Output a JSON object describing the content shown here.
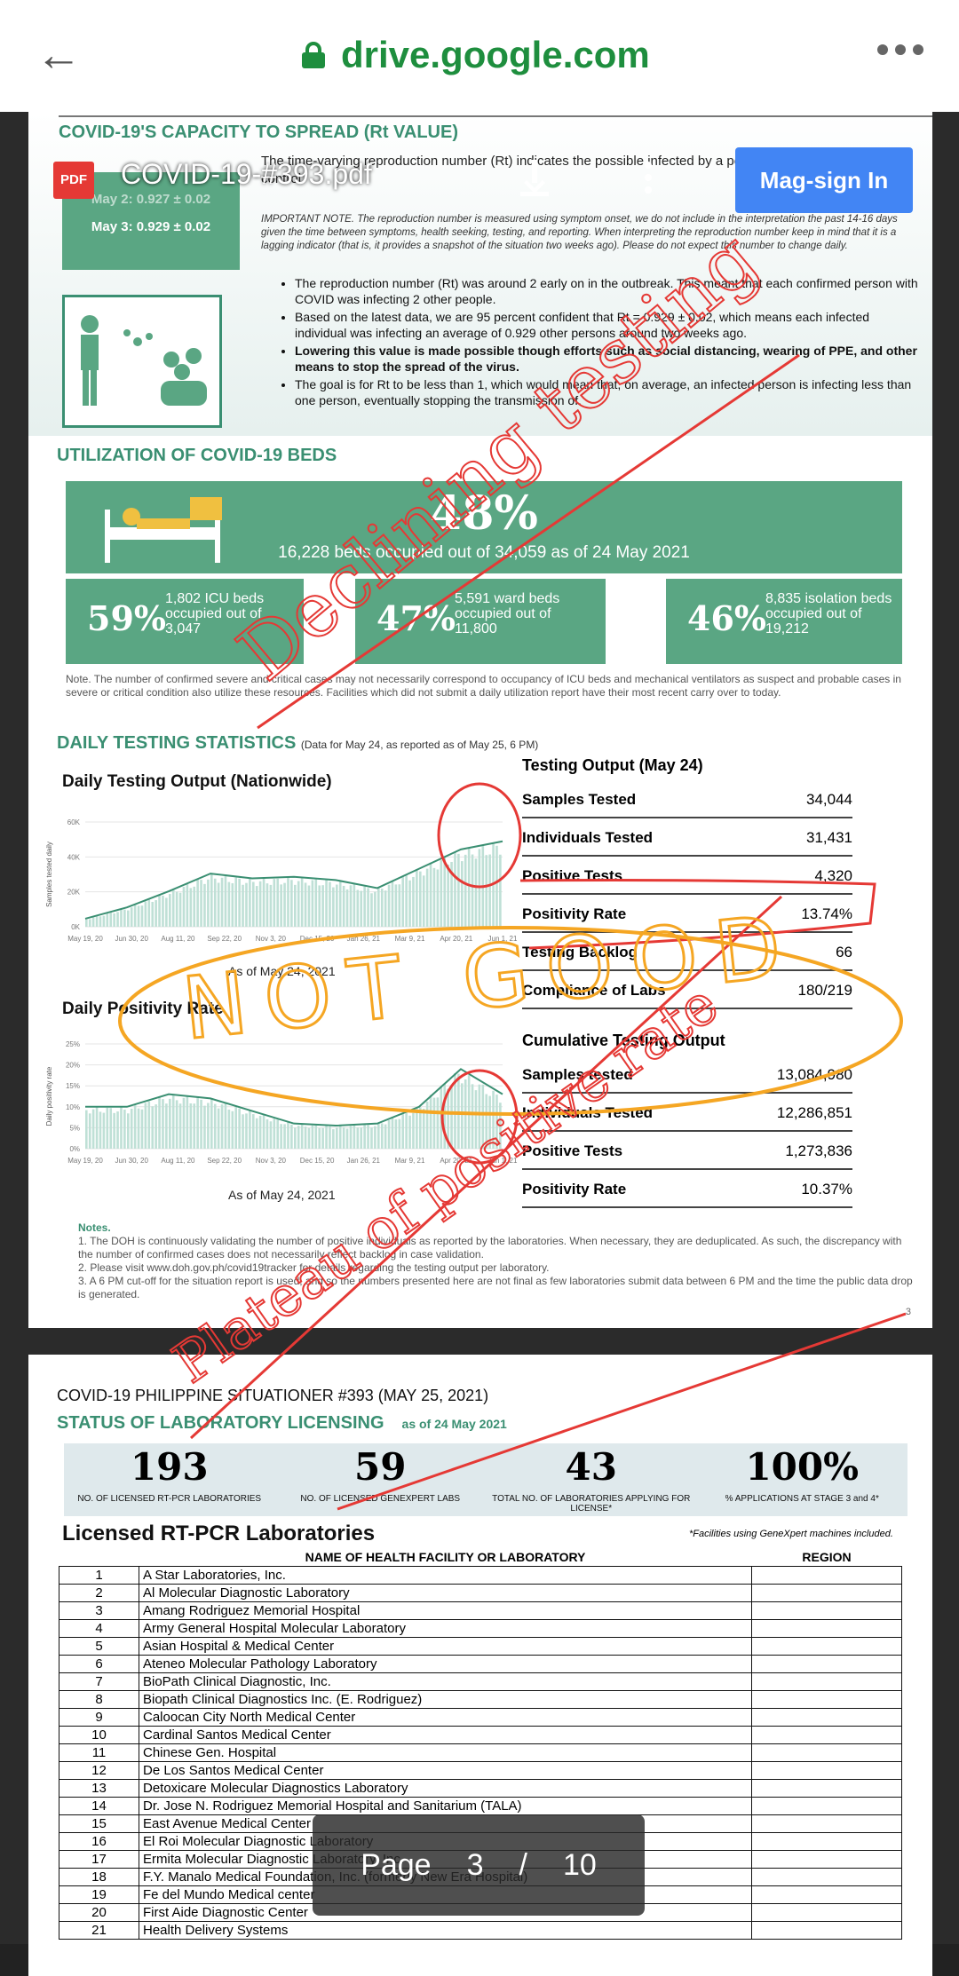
{
  "browser": {
    "url": "drive.google.com"
  },
  "pdf_toolbar": {
    "badge": "PDF",
    "file_name": "COVID-19-#393.pdf",
    "sign_in_label": "Mag-sign In"
  },
  "rt_section": {
    "title": "COVID-19'S CAPACITY TO SPREAD (Rt VALUE)",
    "box_line1": "May 2: 0.927 ± 0.02",
    "box_line2": "May 3: 0.929 ± 0.02",
    "intro": "The time-varying reproduction number (Rt) indicates the possible infected by a person, at a specific time with control",
    "important_note": "IMPORTANT NOTE. The reproduction number is measured using symptom onset, we do not include in the interpretation the past 14-16 days given the time between symptoms, health seeking, testing, and reporting. When interpreting the reproduction number keep in mind that it is a lagging indicator (that is, it provides a snapshot of the situation two weeks ago). Please do not expect this number to change daily.",
    "bullets": [
      "The reproduction number (Rt) was around 2 early on in the outbreak. This meant that each confirmed person with COVID was infecting 2 other people.",
      "Based on the latest data, we are 95 percent confident that Rt = 0.929 ± 0.02, which means each infected individual was infecting an average of 0.929 other persons around two weeks ago.",
      "Lowering this value is made possible though efforts such as social distancing, wearing of PPE, and other means to stop the spread of the virus.",
      "The goal is for Rt to be less than 1, which would mean that, on average, an infected person is infecting less than one person, eventually stopping the transmission of."
    ]
  },
  "utilization": {
    "title": "UTILIZATION OF COVID-19 BEDS",
    "overall_pct": "48%",
    "overall_text": "16,228 beds occupied out of 34,059 as of 24 May 2021",
    "icu_pct": "59%",
    "icu_text": "1,802 ICU beds occupied out of 3,047",
    "ward_pct": "47%",
    "ward_text": "5,591 ward beds occupied out of 11,800",
    "iso_pct": "46%",
    "iso_text": "8,835 isolation beds occupied out of 19,212",
    "note": "Note. The number of confirmed severe and critical cases may not necessarily correspond to occupancy of ICU beds and mechanical ventilators as suspect and probable cases in severe or critical condition also utilize these resources. Facilities which did not submit a daily utilization report have their most recent carry over to today."
  },
  "testing": {
    "title": "DAILY TESTING STATISTICS",
    "subtitle": "(Data for May 24, as reported as of May 25, 6 PM)",
    "output_chart_title": "Daily Testing Output (Nationwide)",
    "positivity_chart_title": "Daily Positivity Rate",
    "as_of_1": "As of May 24, 2021",
    "as_of_2": "As of May 24, 2021",
    "daily_header": "Testing Output (May 24)",
    "daily_rows": [
      {
        "label": "Samples Tested",
        "value": "34,044"
      },
      {
        "label": "Individuals Tested",
        "value": "31,431"
      },
      {
        "label": "Positive Tests",
        "value": "4,320"
      },
      {
        "label": "Positivity Rate",
        "value": "13.74%"
      },
      {
        "label": "Testing Backlog",
        "value": "66"
      },
      {
        "label": "Compliance of Labs",
        "value": "180/219"
      }
    ],
    "cum_header": "Cumulative Testing Output",
    "cum_rows": [
      {
        "label": "Samples tested",
        "value": "13,084,980"
      },
      {
        "label": "Individuals Tested",
        "value": "12,286,851"
      },
      {
        "label": "Positive Tests",
        "value": "1,273,836"
      },
      {
        "label": "Positivity Rate",
        "value": "10.37%"
      }
    ],
    "notes_title": "Notes.",
    "notes": [
      "1. The DOH is continuously validating the number of positive individuals as reported by the laboratories. When necessary, they are deduplicated. As such, the discrepancy with the number of confirmed cases does not necessarily reflect backlog in case validation.",
      "2. Please visit www.doh.gov.ph/covid19tracker for details regarding the testing output per laboratory.",
      "3. A 6 PM cut-off for the situation report is used, and so the numbers presented here are not final as few laboratories submit data between 6 PM and the time the public data drop is generated."
    ],
    "page_number": "3"
  },
  "chart_data": [
    {
      "type": "area",
      "title": "Daily Testing Output (Nationwide)",
      "ylabel": "Samples tested daily",
      "x": [
        "May 19, 20",
        "Jun 30, 20",
        "Aug 11, 20",
        "Sep 22, 20",
        "Nov 3, 20",
        "Dec 15, 20",
        "Jan 26, 21",
        "Mar 9, 21",
        "Apr 20, 21",
        "Jun 1, 21"
      ],
      "y_ticks": [
        "0K",
        "20K",
        "40K",
        "60K"
      ],
      "ylim": [
        0,
        65000
      ],
      "values": [
        5000,
        12000,
        22000,
        33000,
        30000,
        31000,
        29000,
        24000,
        36000,
        48000,
        53000
      ]
    },
    {
      "type": "area",
      "title": "Daily Positivity Rate",
      "ylabel": "Daily positivity rate",
      "x": [
        "May 19, 20",
        "Jun 30, 20",
        "Aug 11, 20",
        "Sep 22, 20",
        "Nov 3, 20",
        "Dec 15, 20",
        "Jan 26, 21",
        "Mar 9, 21",
        "Apr 20, 21",
        "Jun 1, 21"
      ],
      "y_ticks": [
        "0%",
        "5%",
        "10%",
        "15%",
        "20%",
        "25%"
      ],
      "ylim": [
        0,
        25
      ],
      "values": [
        10,
        10,
        13,
        12,
        9,
        6,
        5.5,
        6,
        10,
        19,
        13
      ]
    }
  ],
  "page2": {
    "situationer": "COVID-19 PHILIPPINE SITUATIONER #393 (MAY 25, 2021)",
    "lic_title": "STATUS OF LABORATORY LICENSING",
    "lic_asof": "as of 24 May 2021",
    "stats": [
      {
        "num": "193",
        "label": "NO. OF LICENSED RT-PCR LABORATORIES"
      },
      {
        "num": "59",
        "label": "NO. OF LICENSED GENEXPERT LABS"
      },
      {
        "num": "43",
        "label": "TOTAL NO. OF LABORATORIES APPLYING FOR LICENSE*"
      },
      {
        "num": "100%",
        "label": "% APPLICATIONS AT STAGE 3 and 4*"
      }
    ],
    "rtpcr_title": "Licensed RT-PCR Laboratories",
    "gx_note": "*Facilities using GeneXpert machines included.",
    "col_name": "NAME OF HEALTH FACILITY OR LABORATORY",
    "col_region": "REGION",
    "labs": [
      "A Star Laboratories, Inc.",
      "Al Molecular Diagnostic Laboratory",
      "Amang Rodriguez Memorial Hospital",
      "Army General Hospital Molecular Laboratory",
      "Asian Hospital & Medical Center",
      "Ateneo Molecular Pathology Laboratory",
      "BioPath Clinical Diagnostic, Inc.",
      "Biopath Clinical Diagnostics Inc. (E. Rodriguez)",
      "Caloocan City North Medical Center",
      "Cardinal Santos Medical Center",
      "Chinese Gen. Hospital",
      "De Los Santos Medical Center",
      "Detoxicare Molecular Diagnostics Laboratory",
      "Dr. Jose N. Rodriguez Memorial Hospital and Sanitarium (TALA)",
      "East Avenue Medical Center",
      "El Roi Molecular Diagnostic Laboratory",
      "Ermita Molecular Diagnostic Laboratory, Inc.",
      "F.Y. Manalo Medical Foundation, Inc. (formerly New Era Hospital)",
      "Fe del Mundo Medical center",
      "First Aide Diagnostic Center",
      "Health Delivery Systems"
    ]
  },
  "annotations": {
    "ink1": "Declining testing",
    "ink2": "NOT GOOD",
    "ink3": "Plateau of positive rate"
  },
  "pager": {
    "label": "Page",
    "current": "3",
    "sep": "/",
    "total": "10"
  },
  "colors": {
    "accent": "#3a8f72",
    "ink_red": "#e53935",
    "ink_orange": "#f5a623",
    "signin": "#4285f4"
  }
}
